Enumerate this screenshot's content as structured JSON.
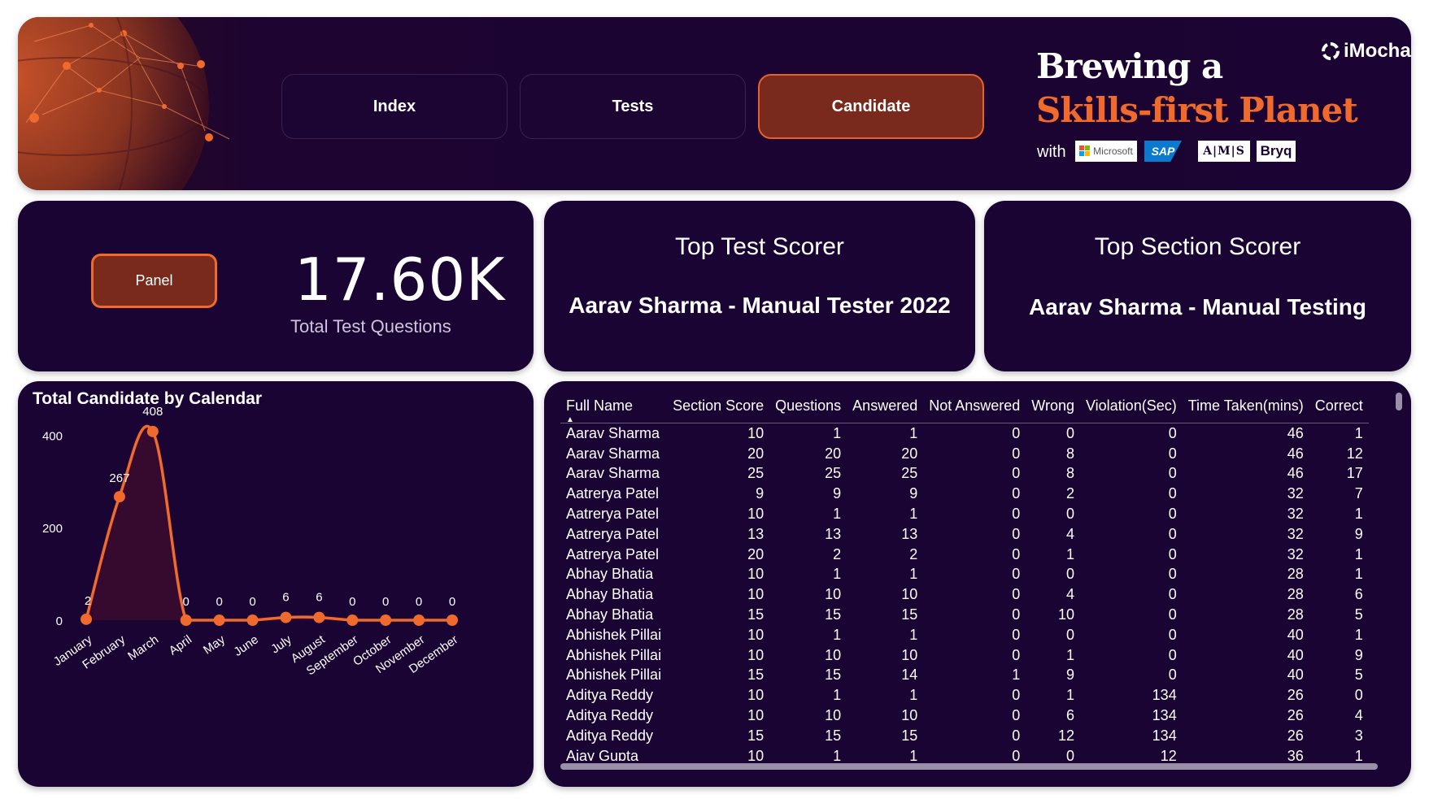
{
  "header": {
    "nav": {
      "index": "Index",
      "tests": "Tests",
      "candidate": "Candidate"
    },
    "tagline_line1": "Brewing a",
    "tagline_line2": "Skills-first Planet",
    "with": "with",
    "partners": {
      "microsoft": "Microsoft",
      "sap": "SAP",
      "ams": "A|M|S",
      "bryq": "Bryq"
    },
    "logo": "iMocha",
    "colors": {
      "accent": "#f06a2e",
      "card_bg": "#1a0433",
      "active_nav": "#7a2a1c"
    }
  },
  "kpi": {
    "panel_button": "Panel",
    "value": "17.60K",
    "label": "Total Test Questions"
  },
  "top_test": {
    "title": "Top Test Scorer",
    "value": "Aarav Sharma - Manual Tester 2022"
  },
  "top_section": {
    "title": "Top Section Scorer",
    "value": "Aarav Sharma - Manual Testing"
  },
  "chart": {
    "title": "Total Candidate by Calendar"
  },
  "chart_data": {
    "type": "line",
    "title": "Total Candidate by Calendar",
    "categories": [
      "January",
      "February",
      "March",
      "April",
      "May",
      "June",
      "July",
      "August",
      "September",
      "October",
      "November",
      "December"
    ],
    "values": [
      2,
      267,
      408,
      0,
      0,
      0,
      6,
      6,
      0,
      0,
      0,
      0
    ],
    "yticks": [
      0,
      200,
      400
    ],
    "ylim": [
      0,
      420
    ],
    "grid": false,
    "area_fill": true,
    "line_color": "#f06a2e"
  },
  "table": {
    "columns": [
      "Full Name",
      "Section Score",
      "Questions",
      "Answered",
      "Not Answered",
      "Wrong",
      "Violation(Sec)",
      "Time Taken(mins)",
      "Correct"
    ],
    "rows": [
      [
        "Aarav Sharma",
        "10",
        "1",
        "1",
        "0",
        "0",
        "0",
        "46",
        "1"
      ],
      [
        "Aarav Sharma",
        "20",
        "20",
        "20",
        "0",
        "8",
        "0",
        "46",
        "12"
      ],
      [
        "Aarav Sharma",
        "25",
        "25",
        "25",
        "0",
        "8",
        "0",
        "46",
        "17"
      ],
      [
        "Aatrerya Patel",
        "9",
        "9",
        "9",
        "0",
        "2",
        "0",
        "32",
        "7"
      ],
      [
        "Aatrerya Patel",
        "10",
        "1",
        "1",
        "0",
        "0",
        "0",
        "32",
        "1"
      ],
      [
        "Aatrerya Patel",
        "13",
        "13",
        "13",
        "0",
        "4",
        "0",
        "32",
        "9"
      ],
      [
        "Aatrerya Patel",
        "20",
        "2",
        "2",
        "0",
        "1",
        "0",
        "32",
        "1"
      ],
      [
        "Abhay Bhatia",
        "10",
        "1",
        "1",
        "0",
        "0",
        "0",
        "28",
        "1"
      ],
      [
        "Abhay Bhatia",
        "10",
        "10",
        "10",
        "0",
        "4",
        "0",
        "28",
        "6"
      ],
      [
        "Abhay Bhatia",
        "15",
        "15",
        "15",
        "0",
        "10",
        "0",
        "28",
        "5"
      ],
      [
        "Abhishek Pillai",
        "10",
        "1",
        "1",
        "0",
        "0",
        "0",
        "40",
        "1"
      ],
      [
        "Abhishek Pillai",
        "10",
        "10",
        "10",
        "0",
        "1",
        "0",
        "40",
        "9"
      ],
      [
        "Abhishek Pillai",
        "15",
        "15",
        "14",
        "1",
        "9",
        "0",
        "40",
        "5"
      ],
      [
        "Aditya Reddy",
        "10",
        "1",
        "1",
        "0",
        "1",
        "134",
        "26",
        "0"
      ],
      [
        "Aditya Reddy",
        "10",
        "10",
        "10",
        "0",
        "6",
        "134",
        "26",
        "4"
      ],
      [
        "Aditya Reddy",
        "15",
        "15",
        "15",
        "0",
        "12",
        "134",
        "26",
        "3"
      ],
      [
        "Ajay Gupta",
        "10",
        "1",
        "1",
        "0",
        "0",
        "12",
        "36",
        "1"
      ]
    ]
  }
}
